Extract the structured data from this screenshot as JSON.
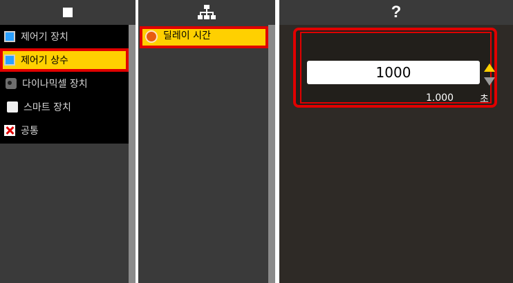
{
  "panel1": {
    "items": [
      {
        "label": "제어기 장치",
        "icon": "monitor-icon"
      },
      {
        "label": "제어기 상수",
        "icon": "monitor-icon",
        "selected": true
      },
      {
        "label": "다이나믹셀 장치",
        "icon": "dynamixel-icon"
      },
      {
        "label": "스마트 장치",
        "icon": "phone-icon"
      },
      {
        "label": "공통",
        "icon": "x-icon"
      }
    ]
  },
  "panel2": {
    "items": [
      {
        "label": "딜레이 시간",
        "icon": "clock-icon",
        "selected": true
      }
    ]
  },
  "panel3": {
    "header_symbol": "?",
    "input_value": "1000",
    "display_value": "1.000",
    "unit": "초"
  },
  "colors": {
    "selected_bg": "#ffd000",
    "highlight_border": "#e00000",
    "panel_bg": "#3a3a3a",
    "list_bg": "#000000"
  }
}
